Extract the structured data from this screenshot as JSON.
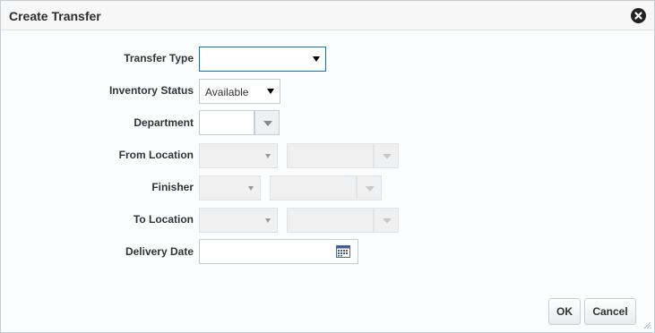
{
  "dialog": {
    "title": "Create Transfer",
    "close_icon": "close-circle-icon"
  },
  "form": {
    "transfer_type": {
      "label": "Transfer Type",
      "value": ""
    },
    "inventory_status": {
      "label": "Inventory Status",
      "value": "Available"
    },
    "department": {
      "label": "Department",
      "value": ""
    },
    "from_location": {
      "label": "From Location"
    },
    "finisher": {
      "label": "Finisher"
    },
    "to_location": {
      "label": "To Location"
    },
    "delivery_date": {
      "label": "Delivery Date",
      "value": "",
      "icon": "calendar-icon"
    }
  },
  "buttons": {
    "ok_label": "OK",
    "cancel_label": "Cancel"
  },
  "colors": {
    "focus_border": "#0572ce",
    "disabled_bg": "#f0f0f0"
  }
}
